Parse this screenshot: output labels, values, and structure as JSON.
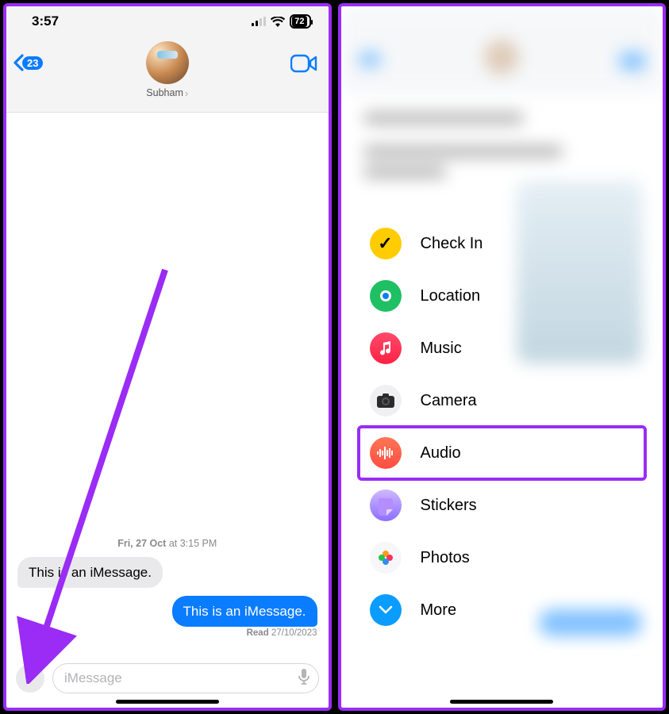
{
  "statusBar": {
    "time": "3:57",
    "battery": "72"
  },
  "nav": {
    "backCount": "23",
    "contactName": "Subham"
  },
  "conversation": {
    "timestampDay": "Fri, 27 Oct",
    "timestampAt": " at ",
    "timestampTime": "3:15 PM",
    "incomingText": "This is an iMessage.",
    "outgoingText": "This is an iMessage.",
    "receiptLabel": "Read",
    "receiptDate": " 27/10/2023"
  },
  "compose": {
    "placeholder": "iMessage"
  },
  "menu": {
    "items": [
      {
        "id": "check-in",
        "label": "Check In"
      },
      {
        "id": "location",
        "label": "Location"
      },
      {
        "id": "music",
        "label": "Music"
      },
      {
        "id": "camera",
        "label": "Camera"
      },
      {
        "id": "audio",
        "label": "Audio",
        "highlight": true
      },
      {
        "id": "stickers",
        "label": "Stickers"
      },
      {
        "id": "photos",
        "label": "Photos"
      },
      {
        "id": "more",
        "label": "More"
      }
    ]
  }
}
